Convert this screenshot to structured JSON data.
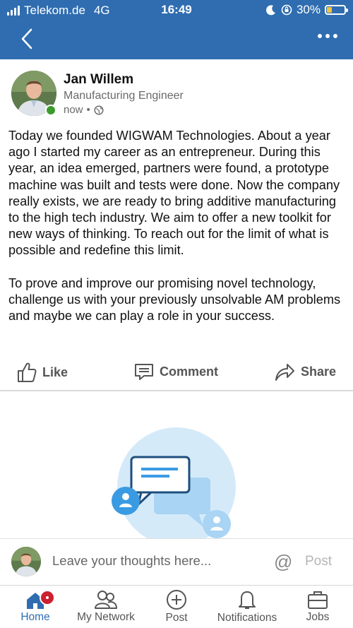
{
  "status_bar": {
    "carrier": "Telekom.de",
    "network": "4G",
    "time": "16:49",
    "battery": "30%",
    "battery_level": 0.3,
    "battery_color": "#f5c242"
  },
  "header": {
    "back_icon": "chevron-left-icon",
    "more_icon": "more-horizontal-icon",
    "background": "#2f6db0"
  },
  "post": {
    "author_name": "Jan Willem",
    "author_title": "Manufacturing Engineer",
    "timestamp": "now",
    "visibility_icon": "globe-icon",
    "online_color": "#3d9a2c",
    "text": "Today we founded WIGWAM Technologies. About a year ago I started my career as an entrepreneur. During this year, an idea emerged, partners were found, a prototype machine was built and tests were done. Now the company really exists, we are ready to bring additive manufacturing to the high tech industry. We aim to offer a new toolkit for new ways of thinking. To reach out for the limit of what is possible and redefine this limit.\n\nTo prove and improve our promising novel technology, challenge us with your previously unsolvable AM problems and maybe we can play a role in your success."
  },
  "actions": {
    "like": "Like",
    "comment": "Comment",
    "share": "Share"
  },
  "comment_bar": {
    "placeholder": "Leave your thoughts here...",
    "mention_symbol": "@",
    "post_label": "Post"
  },
  "bottom_nav": {
    "items": [
      {
        "label": "Home",
        "icon": "home-icon",
        "active": true
      },
      {
        "label": "My Network",
        "icon": "network-icon",
        "active": false
      },
      {
        "label": "Post",
        "icon": "plus-circle-icon",
        "active": false
      },
      {
        "label": "Notifications",
        "icon": "bell-icon",
        "active": false
      },
      {
        "label": "Jobs",
        "icon": "briefcase-icon",
        "active": false
      }
    ],
    "active_color": "#2f6db0",
    "badge_color": "#cc1f2f"
  }
}
